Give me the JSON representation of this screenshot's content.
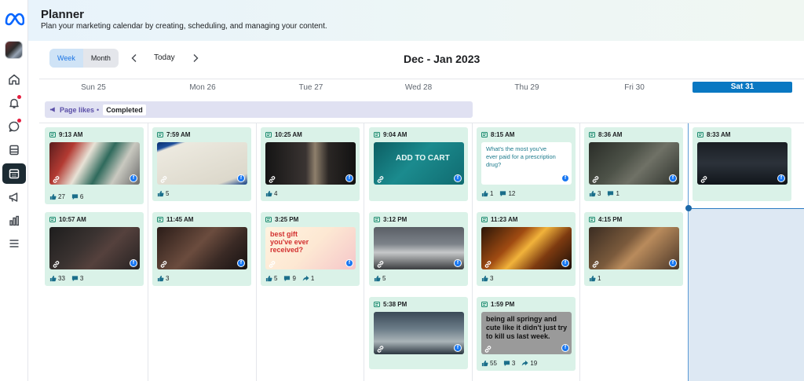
{
  "header": {
    "title": "Planner",
    "subtitle": "Plan your marketing calendar by creating, scheduling, and managing your content."
  },
  "toolbar": {
    "view_week": "Week",
    "view_month": "Month",
    "today": "Today",
    "range": "Dec - Jan 2023",
    "selected_view": "Week"
  },
  "days": [
    {
      "label": "Sun 25"
    },
    {
      "label": "Mon 26"
    },
    {
      "label": "Tue 27"
    },
    {
      "label": "Wed 28"
    },
    {
      "label": "Thu 29"
    },
    {
      "label": "Fri 30"
    },
    {
      "label": "Sat 31"
    }
  ],
  "campaign": {
    "label": "Page likes",
    "separator": "•",
    "status": "Completed"
  },
  "posts": [
    {
      "time": "9:13 AM",
      "likes": "27",
      "comments": "6",
      "shares": null,
      "image": "christmas-ornament"
    },
    {
      "time": "10:57 AM",
      "likes": "33",
      "comments": "3",
      "shares": null,
      "image": "dark-table"
    },
    {
      "time": "7:59 AM",
      "likes": "5",
      "comments": null,
      "shares": null,
      "image": "newspaper"
    },
    {
      "time": "11:45 AM",
      "likes": "3",
      "comments": null,
      "shares": null,
      "image": "dark-kitchen"
    },
    {
      "time": "10:25 AM",
      "likes": "4",
      "comments": null,
      "shares": null,
      "image": "person-hallway"
    },
    {
      "time": "3:25 PM",
      "likes": "5",
      "comments": "9",
      "shares": "1",
      "image": "gift-illustration",
      "text": "best gift you've ever received?"
    },
    {
      "time": "9:04 AM",
      "likes": null,
      "comments": null,
      "shares": null,
      "image": "add-to-cart-key",
      "text": "ADD TO CART"
    },
    {
      "time": "3:12 PM",
      "likes": "5",
      "comments": null,
      "shares": null,
      "image": "white-house"
    },
    {
      "time": "5:38 PM",
      "likes": null,
      "comments": null,
      "shares": null,
      "image": "frozen-pier"
    },
    {
      "time": "8:15 AM",
      "likes": "1",
      "comments": "12",
      "shares": null,
      "image": "text-post",
      "text": "What's the most you've ever paid for a prescription drug?"
    },
    {
      "time": "11:23 AM",
      "likes": "3",
      "comments": null,
      "shares": null,
      "image": "fire"
    },
    {
      "time": "1:59 PM",
      "likes": "55",
      "comments": "3",
      "shares": "19",
      "image": "text-meme",
      "text": "being all springy and cute like it didn't just try to kill us last week."
    },
    {
      "time": "8:36 AM",
      "likes": "3",
      "comments": "1",
      "shares": null,
      "image": "forest"
    },
    {
      "time": "4:15 PM",
      "likes": "1",
      "comments": null,
      "shares": null,
      "image": "dinner-table"
    },
    {
      "time": "8:33 AM",
      "likes": null,
      "comments": null,
      "shares": null,
      "image": "dark-sky"
    }
  ],
  "colors": {
    "accent": "#1b74e4",
    "today_header": "#0a78c2",
    "card_bg": "#daf2e8",
    "campaign_bg": "#e0e1f2",
    "notification_dot": "#e41e3f"
  },
  "icons": [
    "meta-logo",
    "home-icon",
    "bell-icon",
    "chat-icon",
    "content-icon",
    "planner-icon",
    "megaphone-icon",
    "insights-icon",
    "menu-icon",
    "post-icon",
    "link-icon",
    "facebook-icon",
    "like-icon",
    "comment-icon",
    "share-icon"
  ]
}
